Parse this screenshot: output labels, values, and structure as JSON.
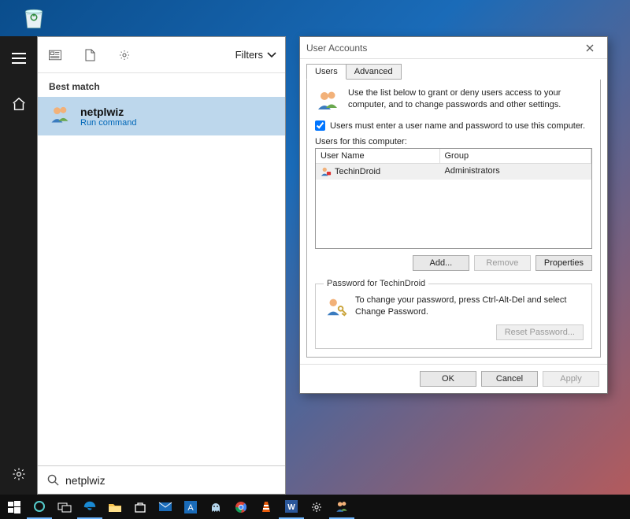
{
  "desktop": {
    "recycle_bin": "Recycle Bin"
  },
  "rail": {
    "menu": "menu",
    "home": "home",
    "settings": "settings"
  },
  "search": {
    "filters_label": "Filters",
    "best_match_header": "Best match",
    "result": {
      "title": "netplwiz",
      "subtitle": "Run command"
    },
    "input_value": "netplwiz"
  },
  "dialog": {
    "title": "User Accounts",
    "tabs": {
      "users": "Users",
      "advanced": "Advanced"
    },
    "intro_text": "Use the list below to grant or deny users access to your computer, and to change passwords and other settings.",
    "checkbox_label": "Users must enter a user name and password to use this computer.",
    "checkbox_checked": true,
    "users_label": "Users for this computer:",
    "columns": {
      "name": "User Name",
      "group": "Group"
    },
    "rows": [
      {
        "name": "TechinDroid",
        "group": "Administrators"
      }
    ],
    "buttons": {
      "add": "Add...",
      "remove": "Remove",
      "properties": "Properties"
    },
    "password_group_legend": "Password for TechinDroid",
    "password_text": "To change your password, press Ctrl-Alt-Del and select Change Password.",
    "reset_button": "Reset Password...",
    "footer": {
      "ok": "OK",
      "cancel": "Cancel",
      "apply": "Apply"
    }
  }
}
